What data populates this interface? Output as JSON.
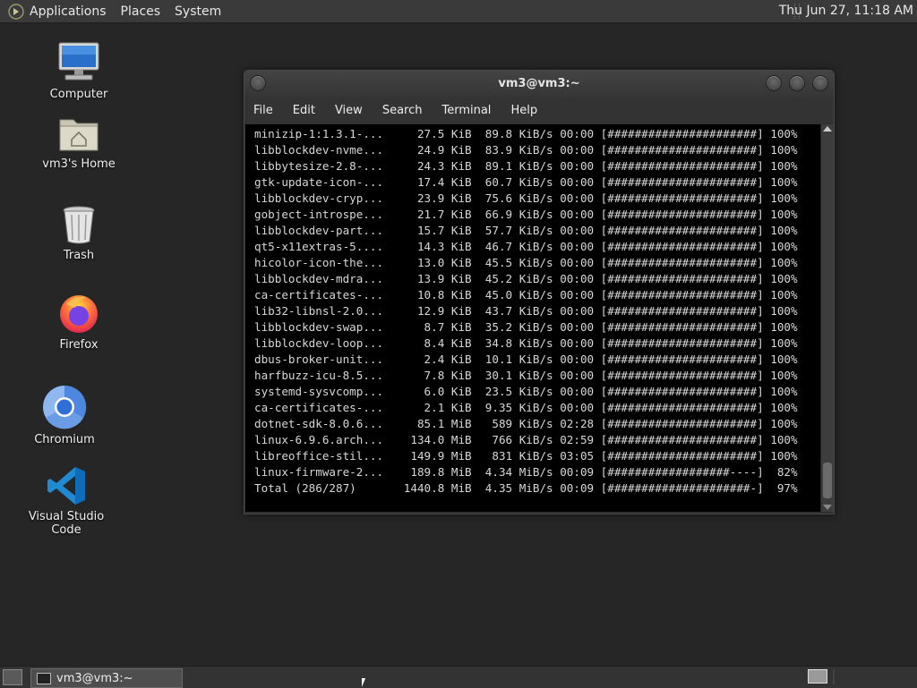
{
  "top_panel": {
    "menus": [
      "Applications",
      "Places",
      "System"
    ],
    "clock": "Thu Jun 27, 11:18 AM"
  },
  "desktop_icons": [
    {
      "label": "Computer",
      "icon": "computer-icon"
    },
    {
      "label": "vm3's Home",
      "icon": "home-folder-icon"
    },
    {
      "label": "Trash",
      "icon": "trash-icon"
    },
    {
      "label": "Firefox",
      "icon": "firefox-icon"
    },
    {
      "label": "Chromium",
      "icon": "chromium-icon"
    },
    {
      "label": "Visual Studio Code",
      "icon": "vscode-icon"
    }
  ],
  "terminal": {
    "title": "vm3@vm3:~",
    "menu": [
      "File",
      "Edit",
      "View",
      "Search",
      "Terminal",
      "Help"
    ],
    "lines": [
      "minizip-1:1.3.1-...     27.5 KiB  89.8 KiB/s 00:00 [######################] 100%",
      "libblockdev-nvme...     24.9 KiB  83.9 KiB/s 00:00 [######################] 100%",
      "libbytesize-2.8-...     24.3 KiB  89.1 KiB/s 00:00 [######################] 100%",
      "gtk-update-icon-...     17.4 KiB  60.7 KiB/s 00:00 [######################] 100%",
      "libblockdev-cryp...     23.9 KiB  75.6 KiB/s 00:00 [######################] 100%",
      "gobject-introspe...     21.7 KiB  66.9 KiB/s 00:00 [######################] 100%",
      "libblockdev-part...     15.7 KiB  57.7 KiB/s 00:00 [######################] 100%",
      "qt5-x11extras-5....     14.3 KiB  46.7 KiB/s 00:00 [######################] 100%",
      "hicolor-icon-the...     13.0 KiB  45.5 KiB/s 00:00 [######################] 100%",
      "libblockdev-mdra...     13.9 KiB  45.2 KiB/s 00:00 [######################] 100%",
      "ca-certificates-...     10.8 KiB  45.0 KiB/s 00:00 [######################] 100%",
      "lib32-libnsl-2.0...     12.9 KiB  43.7 KiB/s 00:00 [######################] 100%",
      "libblockdev-swap...      8.7 KiB  35.2 KiB/s 00:00 [######################] 100%",
      "libblockdev-loop...      8.4 KiB  34.8 KiB/s 00:00 [######################] 100%",
      "dbus-broker-unit...      2.4 KiB  10.1 KiB/s 00:00 [######################] 100%",
      "harfbuzz-icu-8.5...      7.8 KiB  30.1 KiB/s 00:00 [######################] 100%",
      "systemd-sysvcomp...      6.0 KiB  23.5 KiB/s 00:00 [######################] 100%",
      "ca-certificates-...      2.1 KiB  9.35 KiB/s 00:00 [######################] 100%",
      "dotnet-sdk-8.0.6...     85.1 MiB   589 KiB/s 02:28 [######################] 100%",
      "linux-6.9.6.arch...    134.0 MiB   766 KiB/s 02:59 [######################] 100%",
      "libreoffice-stil...    149.9 MiB   831 KiB/s 03:05 [######################] 100%",
      "linux-firmware-2...    189.8 MiB  4.34 MiB/s 00:09 [##################----]  82%",
      "Total (286/287)       1440.8 MiB  4.35 MiB/s 00:09 [#####################-]  97%"
    ]
  },
  "taskbar": {
    "task_label": "vm3@vm3:~"
  }
}
